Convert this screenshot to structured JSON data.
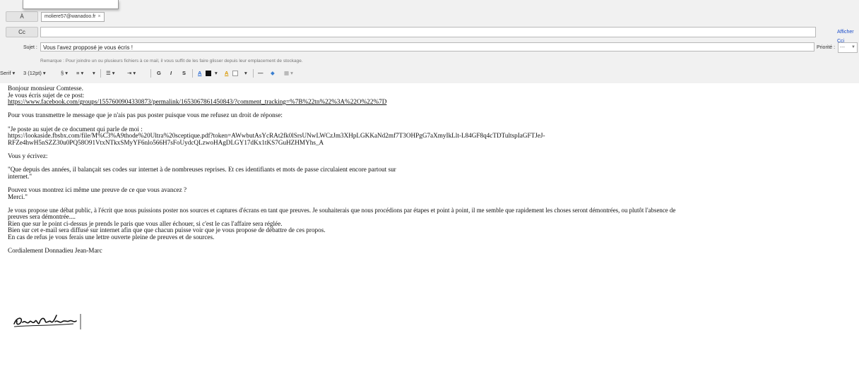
{
  "header": {
    "to_label": "À",
    "to_chip": "moliere57@wanadoo.fr",
    "chip_close": "×",
    "cc_label": "Cc",
    "bcc_link": "Afficher Cci",
    "subject_label": "Sujet :",
    "subject_value": "Vous  l'avez propposé je vous écris !",
    "priority_label": "Priorité :",
    "priority_value": "---",
    "note": "Remarque : Pour joindre un ou plusieurs fichiers à ce mail, il vous suffit de les faire glisser depuis leur emplacement de stockage."
  },
  "toolbar": {
    "font": "Serif ▾",
    "size": "3 (12pt) ▾",
    "style": "§ ▾",
    "align": "≡ ▾",
    "list": "☰ ▾",
    "indent": "⇥ ▾",
    "bold": "G",
    "italic": "I",
    "underline": "S",
    "color": "A",
    "highlight": "A",
    "hr": "—",
    "table": "▦ ▾"
  },
  "body": {
    "l1": "Bonjour monsieur Comtesse.",
    "l2": "Je vous écris sujet de ce post:",
    "l3_url": "https://www.facebook.com/groups/1557600904330873/permalink/1653067861450843/?comment_tracking=%7B%22tn%22%3A%22O%22%7D",
    "l4": "Pour vous transmettre le message que je n'ais pas pus poster puisque vous me refusez un droit de réponse:",
    "l5": "\"Je poste au sujet de ce document qui parle de moi :",
    "l6": "https://lookaside.fbsbx.com/file/M%C3%A9thode%20Ultra%20sceptique.pdf?token=AWwbutAsYcRAt2fk0lSrsUNwLWCzJm3XHpLGKKaNd2mf7T3OHPgG7aXmyIkLlt-L84GF8q4cTDTultspIaGFTJeJ-",
    "l7": "RFZe4hwH5nSZZ30u0PQ58O91VtxNTkxSMyYF6nlo566H7sFoUydcQLzwoHAgDLGY17dKx1tKS7GuHZHMYhs_A",
    "l8": "Vous y écrivez:",
    "l9": "\"Que depuis des années, il balançait ses codes sur internet à de nombreuses reprises. Et ces identifiants et mots de passe circulaient encore partout sur",
    "l10": "internet.\"",
    "l11": "Pouvez vous montrez ici même une preuve de ce que vous avancez ?",
    "l12": "Merci.\"",
    "l13": "Je vous propose une débat public, à l'écrit que nous puissions poster nos sources et captures d'écrans en tant que preuves. Je souhaiterais que nous procédions par étapes et point à point, il me semble que rapidement les choses seront démontrées, ou plutôt l'absence de",
    "l14": "preuves sera démontrée....",
    "l15": "Rien que sur le point ci-dessus je prends le paris que vous aller échouer, si c'est le cas l'affaire sera réglée.",
    "l16": "Bien sur cet e-mail sera diffusé sur internet afin que que chacun puisse voir que je vous propose de débattre de ces propos.",
    "l17": "En cas de refus je vous ferais une lettre ouverte pleine de preuves et de sources.",
    "l18": "Cordialement Donnadieu Jean-Marc",
    "signature": "Donnadieu"
  }
}
